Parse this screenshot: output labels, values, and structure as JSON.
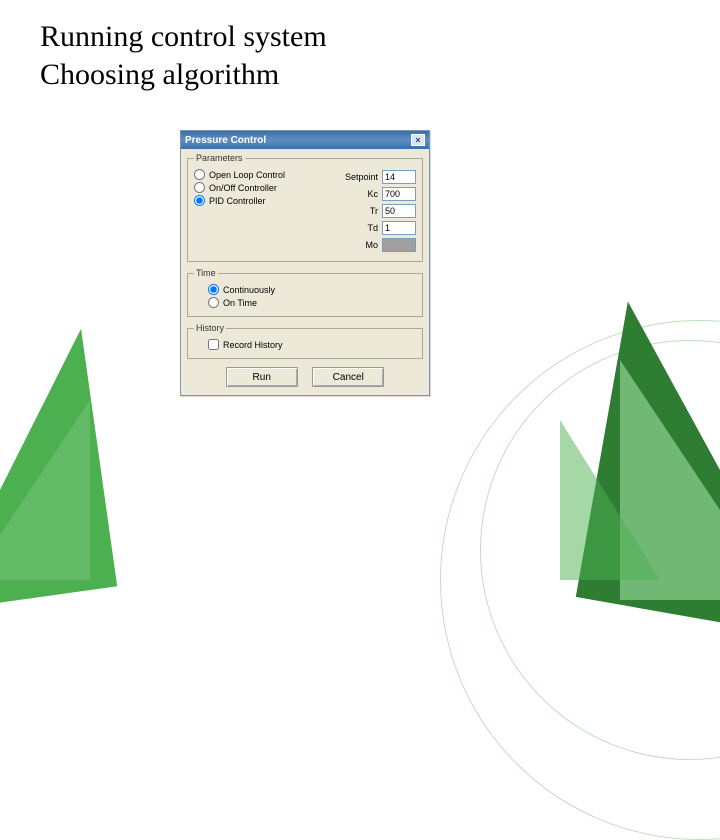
{
  "slide": {
    "title_line1": "Running control system",
    "title_line2": "Choosing algorithm"
  },
  "dialog": {
    "title": "Pressure Control",
    "close_glyph": "×",
    "parameters": {
      "legend": "Parameters",
      "radios": {
        "open_loop": {
          "label": "Open Loop Control",
          "checked": false
        },
        "onoff": {
          "label": "On/Off Controller",
          "checked": false
        },
        "pid": {
          "label": "PID Controller",
          "checked": true
        }
      },
      "fields": {
        "setpoint": {
          "label": "Setpoint",
          "value": "14"
        },
        "kc": {
          "label": "Kc",
          "value": "700"
        },
        "tr": {
          "label": "Tr",
          "value": "50"
        },
        "td": {
          "label": "Td",
          "value": "1"
        },
        "mo": {
          "label": "Mo",
          "value": ""
        }
      }
    },
    "time": {
      "legend": "Time",
      "continuously": {
        "label": "Continuously",
        "checked": true
      },
      "on_time": {
        "label": "On Time",
        "checked": false
      }
    },
    "history": {
      "legend": "History",
      "record": {
        "label": "Record History",
        "checked": false
      }
    },
    "buttons": {
      "run": "Run",
      "cancel": "Cancel"
    }
  }
}
